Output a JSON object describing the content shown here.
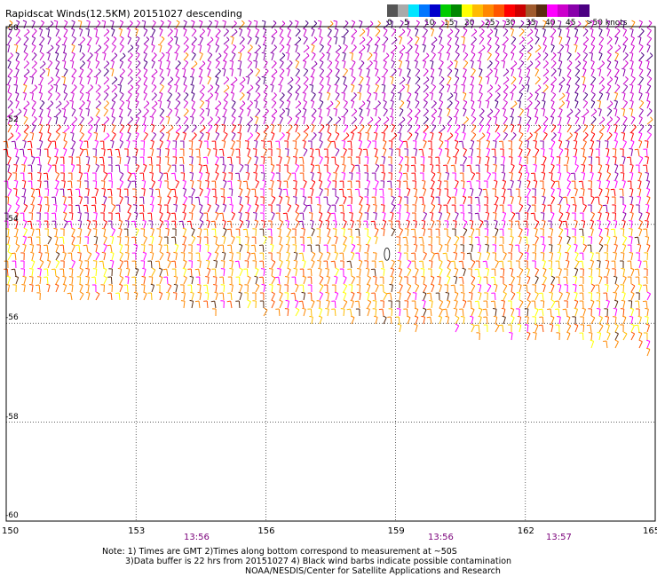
{
  "title": "Rapidscat Winds(12.5KM) 20151027 descending",
  "legend": {
    "labels": [
      "0",
      "5",
      "10",
      "15",
      "20",
      "25",
      "30",
      "35",
      "40",
      "45",
      ">50 knots"
    ],
    "colors": [
      "#555555",
      "#aaaaaa",
      "#00e5ff",
      "#0077ff",
      "#0000cc",
      "#00cc00",
      "#008800",
      "#ffff00",
      "#ffbb00",
      "#ff8800",
      "#ff5500",
      "#ff0000",
      "#cc0000",
      "#a05a2c",
      "#5a2d10",
      "#ff00ff",
      "#cc00cc",
      "#8800aa",
      "#4b0082"
    ]
  },
  "axes": {
    "x_ticks": [
      "150",
      "153",
      "156",
      "159",
      "162",
      "165"
    ],
    "y_ticks": [
      "-50",
      "-52",
      "-54",
      "-56",
      "-58",
      "-60"
    ]
  },
  "times": [
    "13:56",
    "13:56",
    "13:57"
  ],
  "notes": [
    "Note: 1) Times are GMT 2)Times along bottom correspond to measurement at ~50S",
    "3)Data buffer is 22 hrs from 20151027 4) Black wind barbs indicate possible contamination",
    "NOAA/NESDIS/Center for Satellite Applications and Research"
  ],
  "map_data": {
    "lon_range": [
      150,
      165
    ],
    "lat_range": [
      -60,
      -50
    ],
    "swath_south_edge_lat_west": -55.4,
    "swath_south_edge_lat_east": -56.6,
    "data_gap": {
      "lon": 158.8,
      "lat": -54.6
    }
  }
}
